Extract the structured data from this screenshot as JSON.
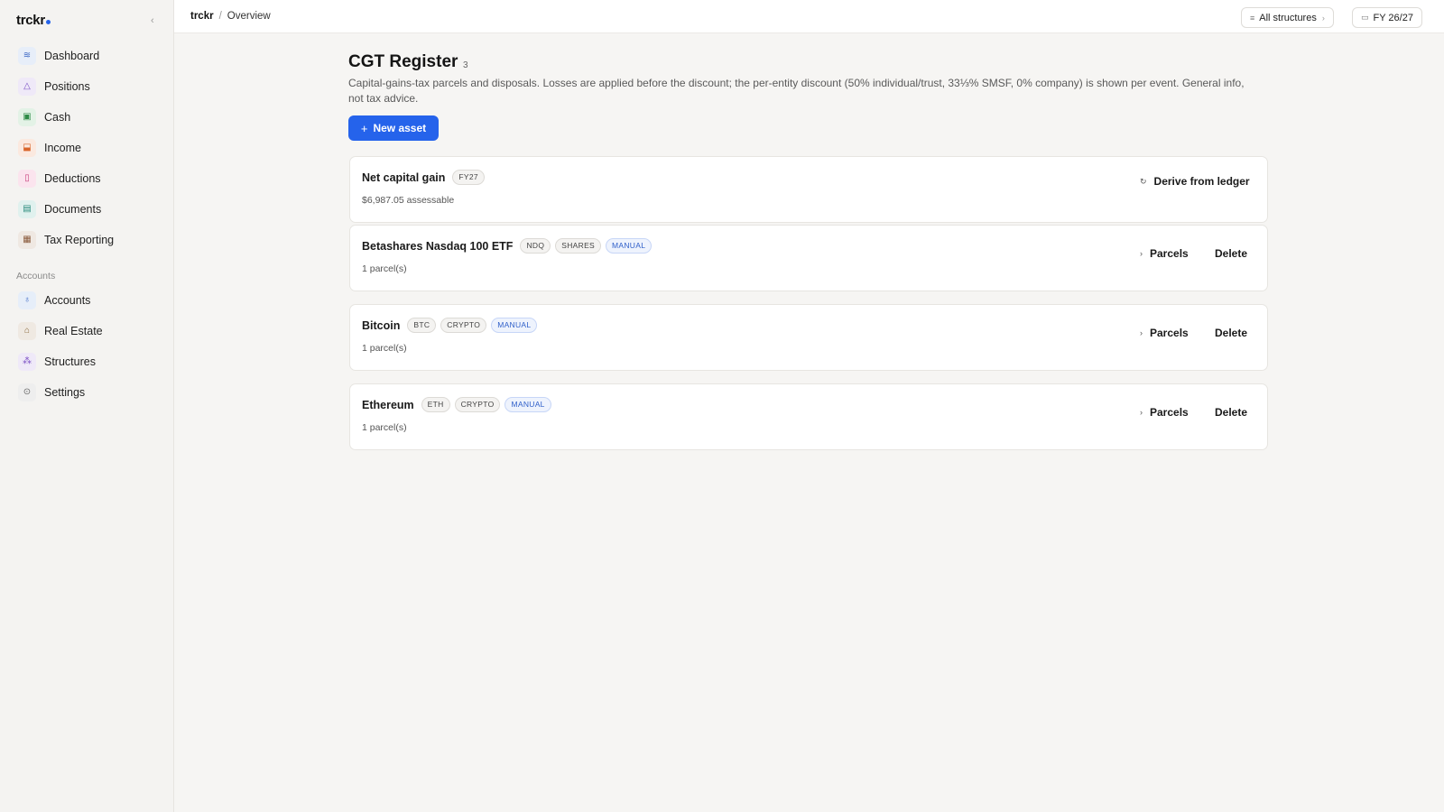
{
  "app": {
    "brand": "trckr"
  },
  "sidebar": {
    "items": [
      {
        "label": "Dashboard",
        "icon": "≋",
        "bg": "#e7eef9",
        "fg": "#3a66c4"
      },
      {
        "label": "Positions",
        "icon": "△",
        "bg": "#efe9f8",
        "fg": "#7b4fc4"
      },
      {
        "label": "Cash",
        "icon": "▣",
        "bg": "#e3f2e6",
        "fg": "#2e8b47"
      },
      {
        "label": "Income",
        "icon": "⬓",
        "bg": "#fbe9df",
        "fg": "#d9652a"
      },
      {
        "label": "Deductions",
        "icon": "▯",
        "bg": "#fbe4ee",
        "fg": "#c8407d"
      },
      {
        "label": "Documents",
        "icon": "▤",
        "bg": "#e0f1ee",
        "fg": "#2a8a7c"
      },
      {
        "label": "Tax Reporting",
        "icon": "▦",
        "bg": "#efe8e2",
        "fg": "#8a5a3c"
      }
    ],
    "section_label": "Accounts",
    "items2": [
      {
        "label": "Accounts",
        "icon": "♁",
        "bg": "#e6eef9",
        "fg": "#3a66c4"
      },
      {
        "label": "Real Estate",
        "icon": "⌂",
        "bg": "#efe9e2",
        "fg": "#8a6a3c"
      },
      {
        "label": "Structures",
        "icon": "⁂",
        "bg": "#efe9f8",
        "fg": "#7b4fc4"
      },
      {
        "label": "Settings",
        "icon": "⊙",
        "bg": "#eeeeee",
        "fg": "#666666"
      }
    ]
  },
  "topbar": {
    "crumb_root": "trckr",
    "crumb_sep": "/",
    "crumb_page": "Overview",
    "structures_label": "All structures",
    "fy_label": "FY 26/27"
  },
  "main": {
    "title": "CGT Register",
    "count": "3",
    "subtitle": "Capital-gains-tax parcels and disposals. Losses are applied before the discount; the per-entity discount (50% individual/trust, 33⅓% SMSF, 0% company) is shown per event. General info, not tax advice.",
    "new_asset_label": "New asset",
    "summary": {
      "title": "Net capital gain",
      "tag": "FY27",
      "sub": "$6,987.05 assessable",
      "action": "Derive from ledger"
    },
    "assets": [
      {
        "name": "Betashares Nasdaq 100 ETF",
        "tags": [
          "NDQ",
          "SHARES",
          "MANUAL"
        ],
        "sub": "1 parcel(s)",
        "parcels": "Parcels",
        "delete": "Delete"
      },
      {
        "name": "Bitcoin",
        "tags": [
          "BTC",
          "CRYPTO",
          "MANUAL"
        ],
        "sub": "1 parcel(s)",
        "parcels": "Parcels",
        "delete": "Delete"
      },
      {
        "name": "Ethereum",
        "tags": [
          "ETH",
          "CRYPTO",
          "MANUAL"
        ],
        "sub": "1 parcel(s)",
        "parcels": "Parcels",
        "delete": "Delete"
      }
    ]
  },
  "colors": {
    "accent": "#2563eb",
    "background": "#f6f5f3",
    "card": "#ffffff"
  }
}
